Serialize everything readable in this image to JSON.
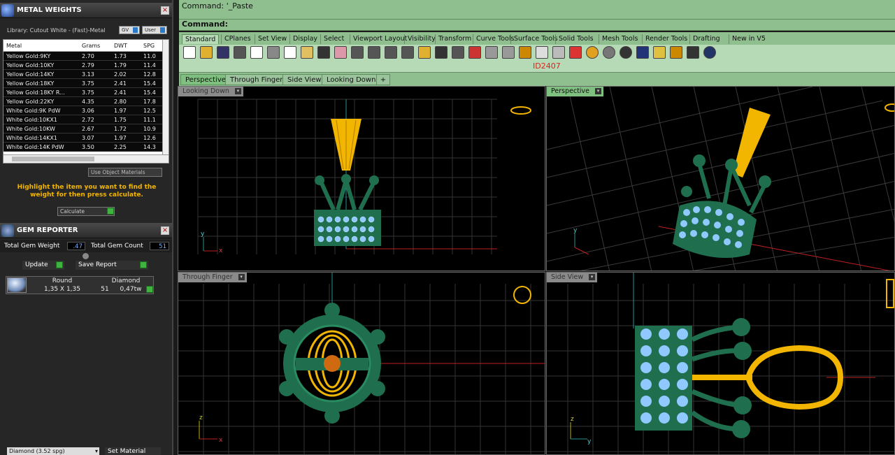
{
  "metal_weights": {
    "title": "METAL WEIGHTS",
    "library": "Library: Cutout White - (Fast)-Metal",
    "gv": "GV",
    "user": "User",
    "columns": [
      "Metal",
      "Grams",
      "DWT",
      "SPG"
    ],
    "rows": [
      [
        "Yellow Gold:9KY",
        "2.70",
        "1.73",
        "11.0"
      ],
      [
        "Yellow Gold:10KY",
        "2.79",
        "1.79",
        "11.4"
      ],
      [
        "Yellow Gold:14KY",
        "3.13",
        "2.02",
        "12.8"
      ],
      [
        "Yellow Gold:18KY",
        "3.75",
        "2.41",
        "15.4"
      ],
      [
        "Yellow Gold:18KY R...",
        "3.75",
        "2.41",
        "15.4"
      ],
      [
        "Yellow Gold:22KY",
        "4.35",
        "2.80",
        "17.8"
      ],
      [
        "White Gold:9K PdW",
        "3.06",
        "1.97",
        "12.5"
      ],
      [
        "White Gold:10KX1",
        "2.72",
        "1.75",
        "11.1"
      ],
      [
        "White Gold:10KW",
        "2.67",
        "1.72",
        "10.9"
      ],
      [
        "White Gold:14KX1",
        "3.07",
        "1.97",
        "12.6"
      ],
      [
        "White Gold:14K PdW",
        "3.50",
        "2.25",
        "14.3"
      ]
    ],
    "use_object_materials": "Use Object Materials",
    "hint": "Highlight the item you want to find the weight for then press calculate.",
    "calculate": "Calculate"
  },
  "gem_reporter": {
    "title": "GEM REPORTER",
    "total_weight_label": "Total Gem Weight",
    "total_weight": ".47",
    "total_count_label": "Total Gem Count",
    "total_count": "51",
    "update": "Update",
    "save_report": "Save Report",
    "gem": {
      "shape": "Round",
      "size": "1,35 X 1,35",
      "material": "Diamond",
      "count": "51",
      "weight": "0,47tw"
    },
    "material_select": "Diamond    (3.52 spg)",
    "set_material": "Set Material"
  },
  "command": {
    "line1": "Command: '_Paste",
    "line2": "Command:"
  },
  "toolbar_tabs": [
    "Standard",
    "CPlanes",
    "Set View",
    "Display",
    "Select",
    "Viewport Layout",
    "Visibility",
    "Transform",
    "Curve Tools",
    "Surface Tools",
    "Solid Tools",
    "Mesh Tools",
    "Render Tools",
    "Drafting",
    "New in V5"
  ],
  "id_label": "ID2407",
  "viewport_tabs": [
    "Perspective",
    "Through Finger",
    "Side View",
    "Looking Down"
  ],
  "viewports": {
    "looking_down": "Looking Down",
    "perspective": "Perspective",
    "through_finger": "Through Finger",
    "side_view": "Side View"
  },
  "colors": {
    "panel_bg": "#262626",
    "rhino_green": "#8fbf8f",
    "gold": "#f2b600",
    "gem": "#8fc9ff",
    "metal_green": "#1f6f4f",
    "axis_red": "#c02020"
  }
}
